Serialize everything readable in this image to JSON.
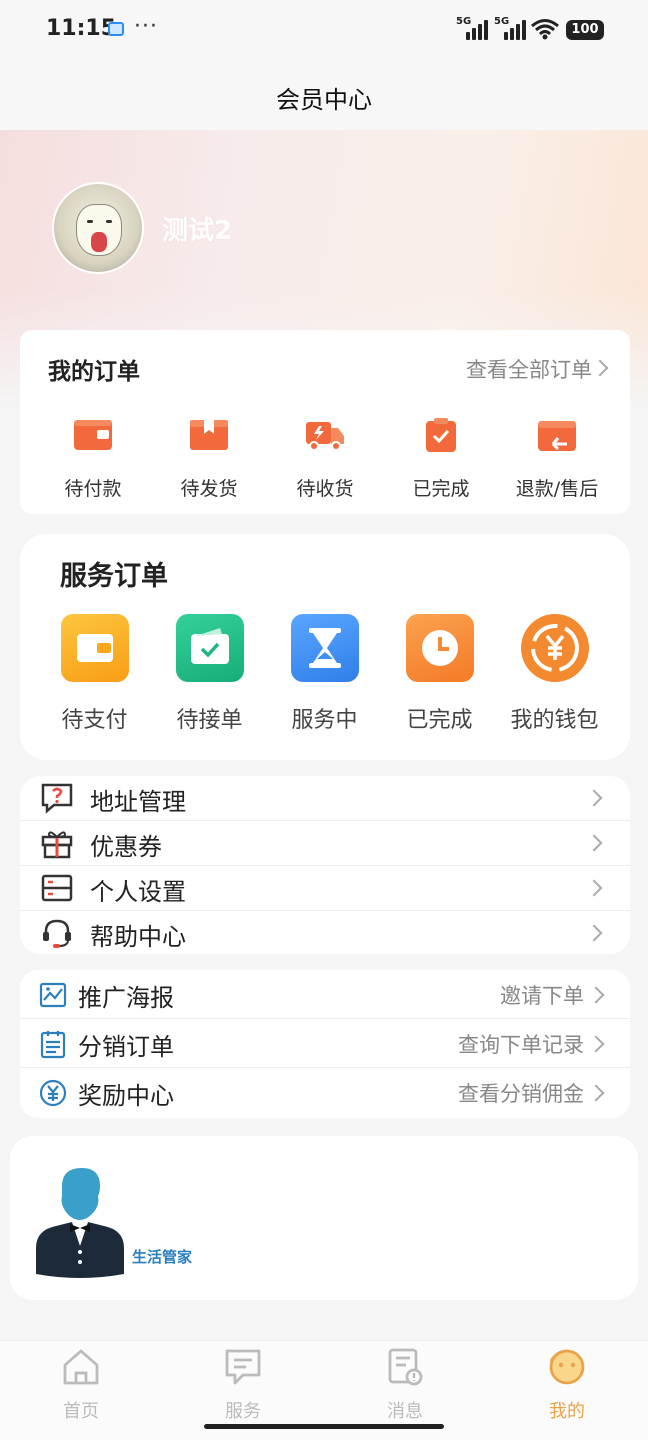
{
  "status_bar": {
    "time": "11:15",
    "dots": "···",
    "signal1_label": "5G",
    "signal2_label": "5G",
    "battery": "100"
  },
  "nav": {
    "title": "会员中心"
  },
  "profile": {
    "username": "测试2"
  },
  "my_orders": {
    "title": "我的订单",
    "view_all": "查看全部订单",
    "items": [
      {
        "label": "待付款",
        "icon": "wallet-icon"
      },
      {
        "label": "待发货",
        "icon": "box-icon"
      },
      {
        "label": "待收货",
        "icon": "truck-icon"
      },
      {
        "label": "已完成",
        "icon": "clipboard-check-icon"
      },
      {
        "label": "退款/售后",
        "icon": "refund-icon"
      }
    ],
    "accent_color": "#f26a3c"
  },
  "service_orders": {
    "title": "服务订单",
    "items": [
      {
        "label": "待支付",
        "icon": "wallet-icon",
        "color": "#fbb42a"
      },
      {
        "label": "待接单",
        "icon": "check-card-icon",
        "color": "#25c089"
      },
      {
        "label": "服务中",
        "icon": "hourglass-icon",
        "color": "#3d8ff5"
      },
      {
        "label": "已完成",
        "icon": "clock-icon",
        "color": "#f78a36"
      },
      {
        "label": "我的钱包",
        "icon": "yuan-coin-icon",
        "color": "#f38a30"
      }
    ]
  },
  "menu": {
    "items": [
      {
        "label": "地址管理",
        "icon": "question-chat-icon"
      },
      {
        "label": "优惠券",
        "icon": "gift-icon"
      },
      {
        "label": "个人设置",
        "icon": "settings-panel-icon"
      },
      {
        "label": "帮助中心",
        "icon": "headset-icon"
      }
    ]
  },
  "promo": {
    "items": [
      {
        "label": "推广海报",
        "hint": "邀请下单",
        "icon": "poster-icon"
      },
      {
        "label": "分销订单",
        "hint": "查询下单记录",
        "icon": "list-icon"
      },
      {
        "label": "奖励中心",
        "hint": "查看分销佣金",
        "icon": "yuan-icon"
      }
    ],
    "icon_color": "#2b7fbf"
  },
  "butler": {
    "label": "生活管家"
  },
  "tabbar": {
    "tabs": [
      {
        "label": "首页",
        "icon": "home-icon"
      },
      {
        "label": "服务",
        "icon": "chat-icon"
      },
      {
        "label": "消息",
        "icon": "message-doc-icon"
      },
      {
        "label": "我的",
        "icon": "smiley-icon",
        "active": true
      }
    ],
    "active_color": "#e9a34a",
    "inactive_color": "#bbbbbb"
  }
}
